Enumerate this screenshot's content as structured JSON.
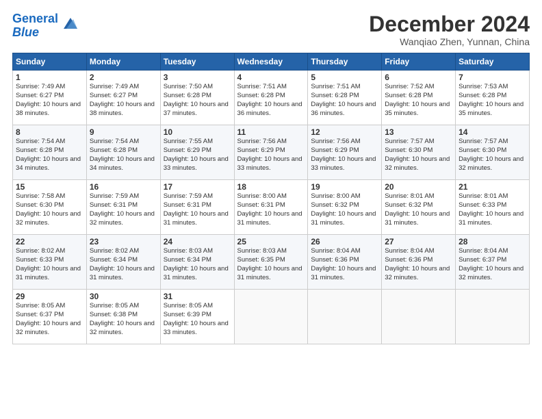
{
  "header": {
    "logo_line1": "General",
    "logo_line2": "Blue",
    "month": "December 2024",
    "location": "Wanqiao Zhen, Yunnan, China"
  },
  "days_of_week": [
    "Sunday",
    "Monday",
    "Tuesday",
    "Wednesday",
    "Thursday",
    "Friday",
    "Saturday"
  ],
  "weeks": [
    [
      {
        "day": "1",
        "sunrise": "7:49 AM",
        "sunset": "6:27 PM",
        "daylight": "10 hours and 38 minutes."
      },
      {
        "day": "2",
        "sunrise": "7:49 AM",
        "sunset": "6:27 PM",
        "daylight": "10 hours and 38 minutes."
      },
      {
        "day": "3",
        "sunrise": "7:50 AM",
        "sunset": "6:28 PM",
        "daylight": "10 hours and 37 minutes."
      },
      {
        "day": "4",
        "sunrise": "7:51 AM",
        "sunset": "6:28 PM",
        "daylight": "10 hours and 36 minutes."
      },
      {
        "day": "5",
        "sunrise": "7:51 AM",
        "sunset": "6:28 PM",
        "daylight": "10 hours and 36 minutes."
      },
      {
        "day": "6",
        "sunrise": "7:52 AM",
        "sunset": "6:28 PM",
        "daylight": "10 hours and 35 minutes."
      },
      {
        "day": "7",
        "sunrise": "7:53 AM",
        "sunset": "6:28 PM",
        "daylight": "10 hours and 35 minutes."
      }
    ],
    [
      {
        "day": "8",
        "sunrise": "7:54 AM",
        "sunset": "6:28 PM",
        "daylight": "10 hours and 34 minutes."
      },
      {
        "day": "9",
        "sunrise": "7:54 AM",
        "sunset": "6:28 PM",
        "daylight": "10 hours and 34 minutes."
      },
      {
        "day": "10",
        "sunrise": "7:55 AM",
        "sunset": "6:29 PM",
        "daylight": "10 hours and 33 minutes."
      },
      {
        "day": "11",
        "sunrise": "7:56 AM",
        "sunset": "6:29 PM",
        "daylight": "10 hours and 33 minutes."
      },
      {
        "day": "12",
        "sunrise": "7:56 AM",
        "sunset": "6:29 PM",
        "daylight": "10 hours and 33 minutes."
      },
      {
        "day": "13",
        "sunrise": "7:57 AM",
        "sunset": "6:30 PM",
        "daylight": "10 hours and 32 minutes."
      },
      {
        "day": "14",
        "sunrise": "7:57 AM",
        "sunset": "6:30 PM",
        "daylight": "10 hours and 32 minutes."
      }
    ],
    [
      {
        "day": "15",
        "sunrise": "7:58 AM",
        "sunset": "6:30 PM",
        "daylight": "10 hours and 32 minutes."
      },
      {
        "day": "16",
        "sunrise": "7:59 AM",
        "sunset": "6:31 PM",
        "daylight": "10 hours and 32 minutes."
      },
      {
        "day": "17",
        "sunrise": "7:59 AM",
        "sunset": "6:31 PM",
        "daylight": "10 hours and 31 minutes."
      },
      {
        "day": "18",
        "sunrise": "8:00 AM",
        "sunset": "6:31 PM",
        "daylight": "10 hours and 31 minutes."
      },
      {
        "day": "19",
        "sunrise": "8:00 AM",
        "sunset": "6:32 PM",
        "daylight": "10 hours and 31 minutes."
      },
      {
        "day": "20",
        "sunrise": "8:01 AM",
        "sunset": "6:32 PM",
        "daylight": "10 hours and 31 minutes."
      },
      {
        "day": "21",
        "sunrise": "8:01 AM",
        "sunset": "6:33 PM",
        "daylight": "10 hours and 31 minutes."
      }
    ],
    [
      {
        "day": "22",
        "sunrise": "8:02 AM",
        "sunset": "6:33 PM",
        "daylight": "10 hours and 31 minutes."
      },
      {
        "day": "23",
        "sunrise": "8:02 AM",
        "sunset": "6:34 PM",
        "daylight": "10 hours and 31 minutes."
      },
      {
        "day": "24",
        "sunrise": "8:03 AM",
        "sunset": "6:34 PM",
        "daylight": "10 hours and 31 minutes."
      },
      {
        "day": "25",
        "sunrise": "8:03 AM",
        "sunset": "6:35 PM",
        "daylight": "10 hours and 31 minutes."
      },
      {
        "day": "26",
        "sunrise": "8:04 AM",
        "sunset": "6:36 PM",
        "daylight": "10 hours and 31 minutes."
      },
      {
        "day": "27",
        "sunrise": "8:04 AM",
        "sunset": "6:36 PM",
        "daylight": "10 hours and 32 minutes."
      },
      {
        "day": "28",
        "sunrise": "8:04 AM",
        "sunset": "6:37 PM",
        "daylight": "10 hours and 32 minutes."
      }
    ],
    [
      {
        "day": "29",
        "sunrise": "8:05 AM",
        "sunset": "6:37 PM",
        "daylight": "10 hours and 32 minutes."
      },
      {
        "day": "30",
        "sunrise": "8:05 AM",
        "sunset": "6:38 PM",
        "daylight": "10 hours and 32 minutes."
      },
      {
        "day": "31",
        "sunrise": "8:05 AM",
        "sunset": "6:39 PM",
        "daylight": "10 hours and 33 minutes."
      },
      null,
      null,
      null,
      null
    ]
  ]
}
